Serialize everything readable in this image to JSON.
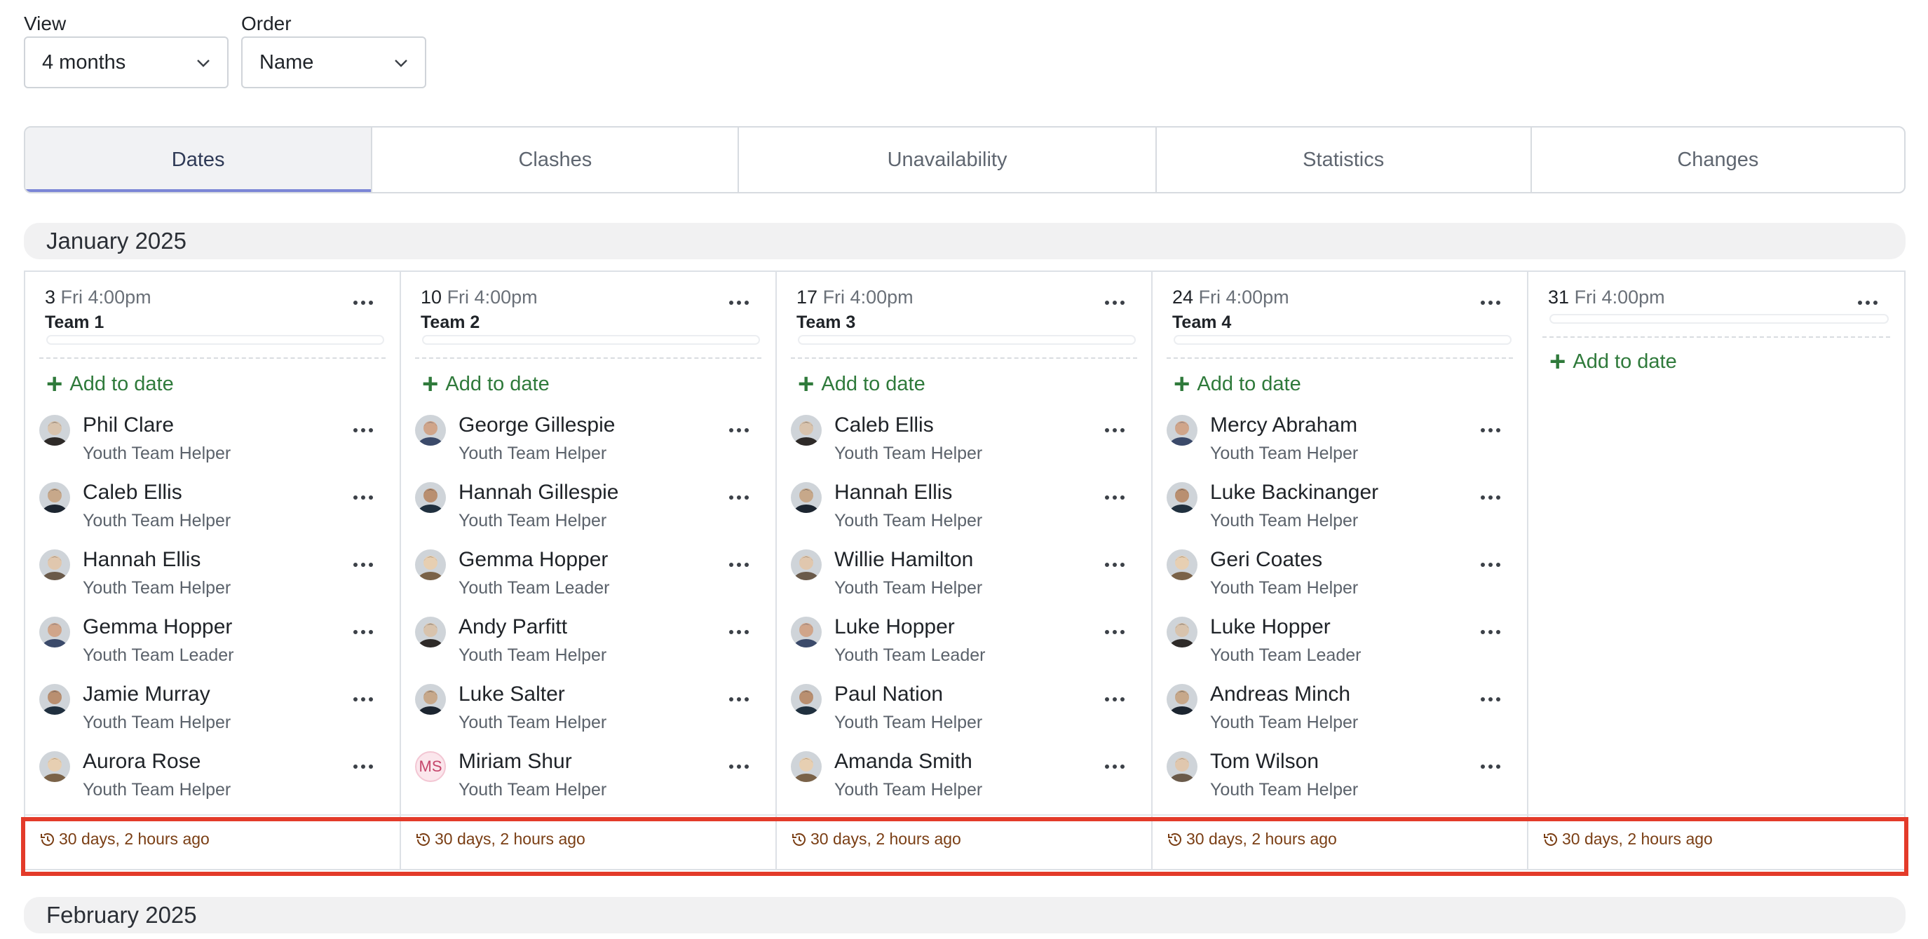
{
  "filters": {
    "view": {
      "label": "View",
      "value": "4 months"
    },
    "order": {
      "label": "Order",
      "value": "Name"
    }
  },
  "tabs": [
    "Dates",
    "Clashes",
    "Unavailability",
    "Statistics",
    "Changes"
  ],
  "active_tab": "Dates",
  "months": {
    "current": "January 2025",
    "next": "February 2025"
  },
  "add_label": "Add to date",
  "columns": [
    {
      "day": "3",
      "when": "Fri 4:00pm",
      "team": "Team 1",
      "people": [
        {
          "name": "Phil Clare",
          "role": "Youth Team Helper"
        },
        {
          "name": "Caleb Ellis",
          "role": "Youth Team Helper"
        },
        {
          "name": "Hannah Ellis",
          "role": "Youth Team Helper"
        },
        {
          "name": "Gemma Hopper",
          "role": "Youth Team Leader"
        },
        {
          "name": "Jamie Murray",
          "role": "Youth Team Helper"
        },
        {
          "name": "Aurora Rose",
          "role": "Youth Team Helper"
        }
      ],
      "changed": "30 days, 2 hours ago"
    },
    {
      "day": "10",
      "when": "Fri 4:00pm",
      "team": "Team 2",
      "people": [
        {
          "name": "George Gillespie",
          "role": "Youth Team Helper"
        },
        {
          "name": "Hannah Gillespie",
          "role": "Youth Team Helper"
        },
        {
          "name": "Gemma Hopper",
          "role": "Youth Team Leader"
        },
        {
          "name": "Andy Parfitt",
          "role": "Youth Team Helper"
        },
        {
          "name": "Luke Salter",
          "role": "Youth Team Helper"
        },
        {
          "name": "Miriam Shur",
          "role": "Youth Team Helper",
          "initials": "MS"
        }
      ],
      "changed": "30 days, 2 hours ago"
    },
    {
      "day": "17",
      "when": "Fri 4:00pm",
      "team": "Team 3",
      "people": [
        {
          "name": "Caleb Ellis",
          "role": "Youth Team Helper"
        },
        {
          "name": "Hannah Ellis",
          "role": "Youth Team Helper"
        },
        {
          "name": "Willie Hamilton",
          "role": "Youth Team Helper"
        },
        {
          "name": "Luke Hopper",
          "role": "Youth Team Leader"
        },
        {
          "name": "Paul Nation",
          "role": "Youth Team Helper"
        },
        {
          "name": "Amanda Smith",
          "role": "Youth Team Helper"
        }
      ],
      "changed": "30 days, 2 hours ago"
    },
    {
      "day": "24",
      "when": "Fri 4:00pm",
      "team": "Team 4",
      "people": [
        {
          "name": "Mercy Abraham",
          "role": "Youth Team Helper"
        },
        {
          "name": "Luke Backinanger",
          "role": "Youth Team Helper"
        },
        {
          "name": "Geri Coates",
          "role": "Youth Team Helper"
        },
        {
          "name": "Luke Hopper",
          "role": "Youth Team Leader"
        },
        {
          "name": "Andreas Minch",
          "role": "Youth Team Helper"
        },
        {
          "name": "Tom Wilson",
          "role": "Youth Team Helper"
        }
      ],
      "changed": "30 days, 2 hours ago"
    },
    {
      "day": "31",
      "when": "Fri 4:00pm",
      "team": "",
      "people": [],
      "changed": "30 days, 2 hours ago"
    }
  ],
  "colors": {
    "add_green": "#2f7a3b",
    "footer_text": "#7a3e14",
    "highlight": "#e33b2a",
    "active_tab_underline": "#7b86d6"
  }
}
